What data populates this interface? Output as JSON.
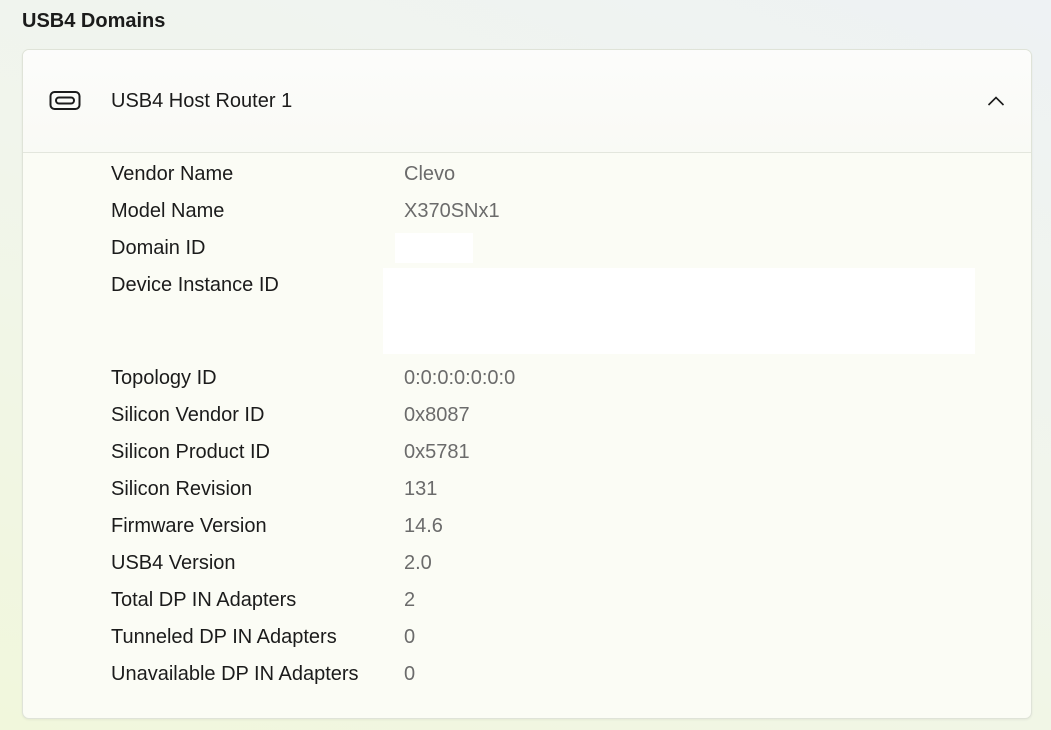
{
  "section": {
    "title": "USB4 Domains"
  },
  "router": {
    "icon": "usb-c-port-icon",
    "title": "USB4 Host Router 1",
    "expanded": true,
    "chevron_icon": "chevron-up-icon"
  },
  "properties": [
    {
      "label": "Vendor Name",
      "value": "Clevo"
    },
    {
      "label": "Model Name",
      "value": "X370SNx1"
    },
    {
      "label": "Domain ID",
      "value": "",
      "redacted": true
    },
    {
      "label": "Device Instance ID",
      "value": "",
      "redacted": true
    },
    {
      "label": "Topology ID",
      "value": "0:0:0:0:0:0:0"
    },
    {
      "label": "Silicon Vendor ID",
      "value": "0x8087"
    },
    {
      "label": "Silicon Product ID",
      "value": "0x5781"
    },
    {
      "label": "Silicon Revision",
      "value": "131"
    },
    {
      "label": "Firmware Version",
      "value": "14.6"
    },
    {
      "label": "USB4 Version",
      "value": "2.0"
    },
    {
      "label": "Total DP IN Adapters",
      "value": "2"
    },
    {
      "label": "Tunneled DP IN Adapters",
      "value": "0"
    },
    {
      "label": "Unavailable DP IN Adapters",
      "value": "0"
    }
  ]
}
